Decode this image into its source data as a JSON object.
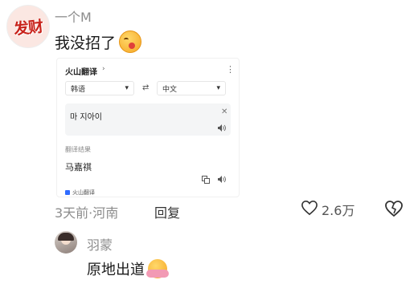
{
  "comment1": {
    "avatar_text": "发财",
    "username": "一个M",
    "text": "我没招了",
    "emoji": "smiling-face-with-tongue",
    "time_location": "3天前·河南",
    "reply_label": "回复",
    "like_count": "2.6万"
  },
  "translate_card": {
    "app_title": "火山翻译",
    "chevron": "›",
    "more": "⋮",
    "source_lang": "韩语",
    "target_lang": "中文",
    "swap": "⇄",
    "input_text": "마 지아이",
    "clear": "✕",
    "result_label": "翻译结果",
    "result_text": "马嘉祺",
    "brand_label": "火山翻译"
  },
  "comment2": {
    "username": "羽蒙",
    "text": "原地出道",
    "emoji": "hugging-face"
  },
  "colors": {
    "muted_text": "#8c8c8c",
    "avatar_red": "#c8221a",
    "brand_blue": "#2f6bff"
  }
}
